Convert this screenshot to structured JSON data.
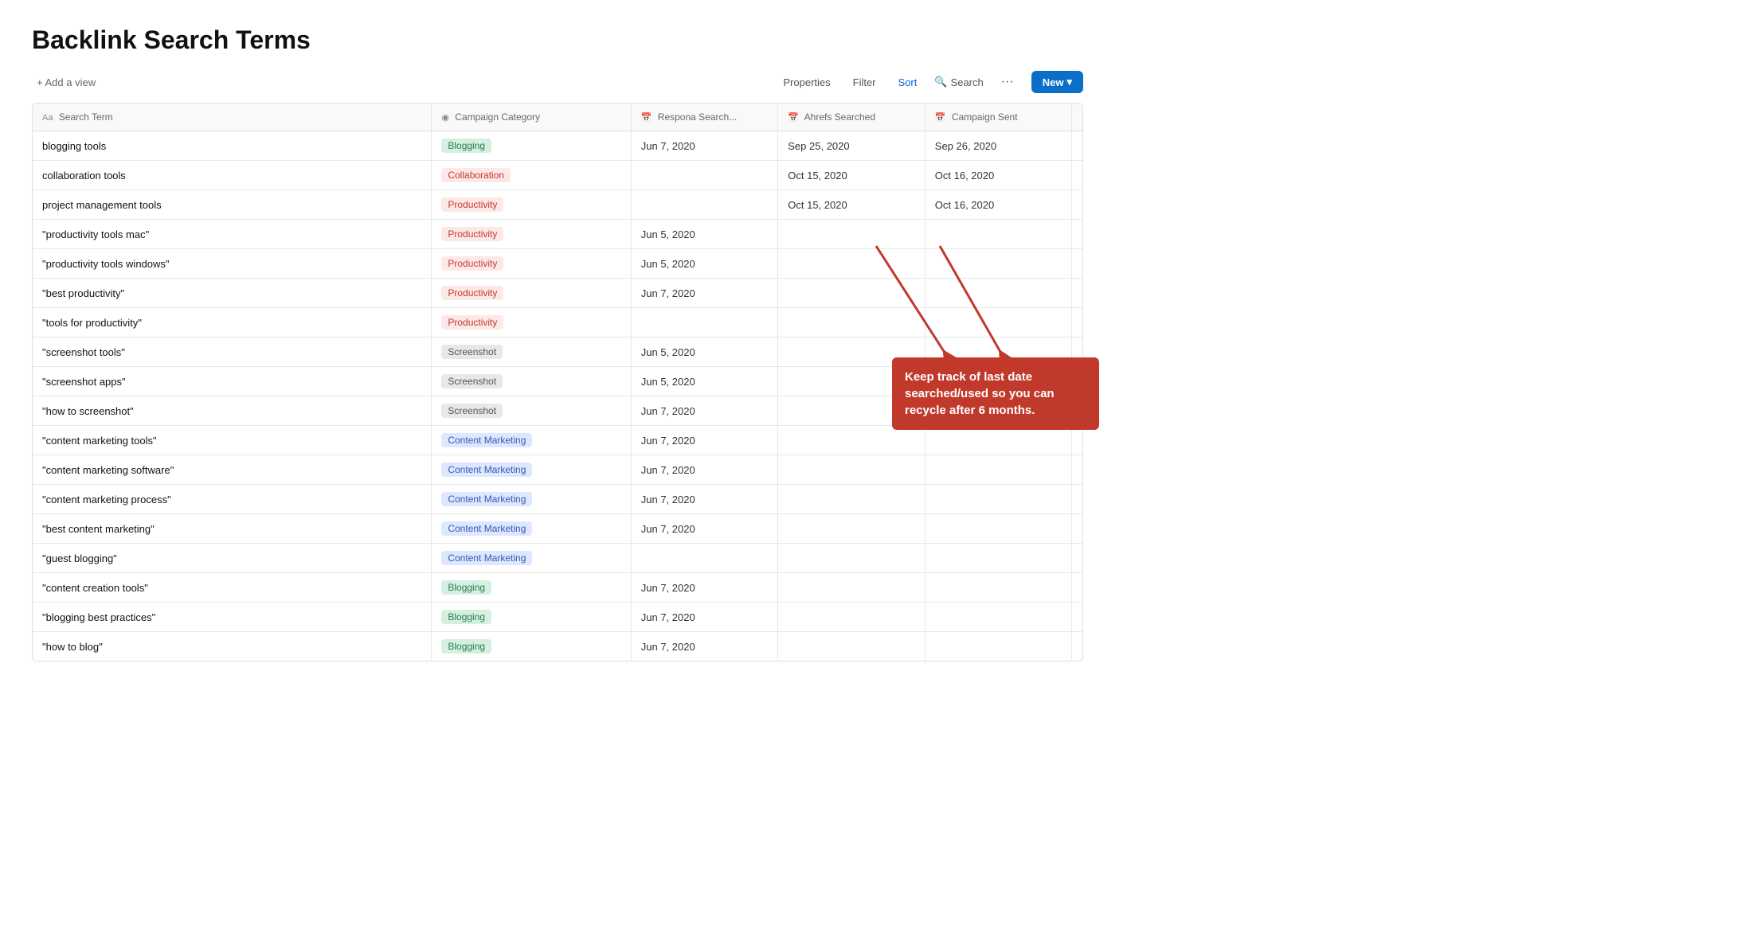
{
  "page": {
    "title": "Backlink Search Terms"
  },
  "toolbar": {
    "add_view_label": "+ Add a view",
    "properties_label": "Properties",
    "filter_label": "Filter",
    "sort_label": "Sort",
    "search_label": "Search",
    "dots_label": "···",
    "new_label": "New",
    "new_dropdown_icon": "▾"
  },
  "table": {
    "columns": [
      {
        "id": "search_term",
        "icon": "Aa",
        "label": "Search Term"
      },
      {
        "id": "campaign_category",
        "icon": "◉",
        "label": "Campaign Category"
      },
      {
        "id": "respona_searched",
        "icon": "📅",
        "label": "Respona Search..."
      },
      {
        "id": "ahrefs_searched",
        "icon": "📅",
        "label": "Ahrefs Searched"
      },
      {
        "id": "campaign_sent",
        "icon": "📅",
        "label": "Campaign Sent"
      },
      {
        "id": "add_col",
        "icon": "+",
        "label": ""
      }
    ],
    "rows": [
      {
        "search_term": "blogging tools",
        "category": "Blogging",
        "category_class": "tag-blogging",
        "respona": "Jun 7, 2020",
        "ahrefs": "Sep 25, 2020",
        "campaign": "Sep 26, 2020"
      },
      {
        "search_term": "collaboration tools",
        "category": "Collaboration",
        "category_class": "tag-collaboration",
        "respona": "",
        "ahrefs": "Oct 15, 2020",
        "campaign": "Oct 16, 2020"
      },
      {
        "search_term": "project management tools",
        "category": "Productivity",
        "category_class": "tag-productivity",
        "respona": "",
        "ahrefs": "Oct 15, 2020",
        "campaign": "Oct 16, 2020"
      },
      {
        "search_term": "\"productivity tools mac\"",
        "category": "Productivity",
        "category_class": "tag-productivity",
        "respona": "Jun 5, 2020",
        "ahrefs": "",
        "campaign": ""
      },
      {
        "search_term": "\"productivity tools windows\"",
        "category": "Productivity",
        "category_class": "tag-productivity",
        "respona": "Jun 5, 2020",
        "ahrefs": "",
        "campaign": ""
      },
      {
        "search_term": "\"best productivity\"",
        "category": "Productivity",
        "category_class": "tag-productivity",
        "respona": "Jun 7, 2020",
        "ahrefs": "",
        "campaign": ""
      },
      {
        "search_term": "\"tools for productivity\"",
        "category": "Productivity",
        "category_class": "tag-productivity",
        "respona": "",
        "ahrefs": "",
        "campaign": ""
      },
      {
        "search_term": "\"screenshot tools\"",
        "category": "Screenshot",
        "category_class": "tag-screenshot",
        "respona": "Jun 5, 2020",
        "ahrefs": "",
        "campaign": ""
      },
      {
        "search_term": "\"screenshot apps\"",
        "category": "Screenshot",
        "category_class": "tag-screenshot",
        "respona": "Jun 5, 2020",
        "ahrefs": "",
        "campaign": ""
      },
      {
        "search_term": "\"how to screenshot\"",
        "category": "Screenshot",
        "category_class": "tag-screenshot",
        "respona": "Jun 7, 2020",
        "ahrefs": "",
        "campaign": ""
      },
      {
        "search_term": "\"content marketing tools\"",
        "category": "Content Marketing",
        "category_class": "tag-content-marketing",
        "respona": "Jun 7, 2020",
        "ahrefs": "",
        "campaign": ""
      },
      {
        "search_term": "\"content marketing software\"",
        "category": "Content Marketing",
        "category_class": "tag-content-marketing",
        "respona": "Jun 7, 2020",
        "ahrefs": "",
        "campaign": ""
      },
      {
        "search_term": "\"content marketing process\"",
        "category": "Content Marketing",
        "category_class": "tag-content-marketing",
        "respona": "Jun 7, 2020",
        "ahrefs": "",
        "campaign": ""
      },
      {
        "search_term": "\"best content marketing\"",
        "category": "Content Marketing",
        "category_class": "tag-content-marketing",
        "respona": "Jun 7, 2020",
        "ahrefs": "",
        "campaign": ""
      },
      {
        "search_term": "\"guest blogging\"",
        "category": "Content Marketing",
        "category_class": "tag-content-marketing",
        "respona": "",
        "ahrefs": "",
        "campaign": ""
      },
      {
        "search_term": "\"content creation tools\"",
        "category": "Blogging",
        "category_class": "tag-blogging",
        "respona": "Jun 7, 2020",
        "ahrefs": "",
        "campaign": ""
      },
      {
        "search_term": "\"blogging best practices\"",
        "category": "Blogging",
        "category_class": "tag-blogging",
        "respona": "Jun 7, 2020",
        "ahrefs": "",
        "campaign": ""
      },
      {
        "search_term": "\"how to blog\"",
        "category": "Blogging",
        "category_class": "tag-blogging",
        "respona": "Jun 7, 2020",
        "ahrefs": "",
        "campaign": ""
      }
    ]
  },
  "annotation": {
    "text": "Keep track of last date searched/used so you can recycle after 6 months."
  }
}
